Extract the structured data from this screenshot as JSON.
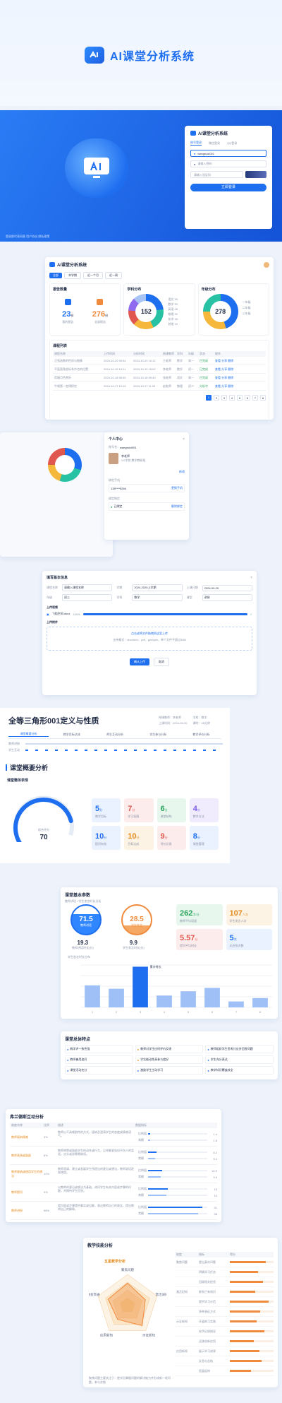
{
  "header": {
    "title": "AI课堂分析系统"
  },
  "login": {
    "title": "AI课堂分析系统",
    "tabs": [
      "账号登录",
      "微信登录",
      "QQ登录"
    ],
    "username": "wangruixi001",
    "password_placeholder": "请输入密码",
    "captcha_placeholder": "请输入验证码",
    "submit": "立即登录",
    "footer": "登录即代表同意 用户协议 隐私政策"
  },
  "dashboard": {
    "title": "AI课堂分析系统",
    "tabs": [
      "全部",
      "本学期",
      "近一个月",
      "近一周"
    ],
    "report_count_title": "报告数量",
    "report_a": {
      "value": "23",
      "unit": "份",
      "label": "我的报告"
    },
    "report_b": {
      "value": "276",
      "unit": "份",
      "label": "全部报告"
    },
    "subject_title": "学科分布",
    "subject_total": "152",
    "subject_legend": [
      "语文 35",
      "数学 30",
      "英语 28",
      "物理 22",
      "化学 18",
      "其他 19"
    ],
    "grade_title": "年级分布",
    "grade_total": "278",
    "grade_legend": [
      "一年级",
      "二年级",
      "三年级"
    ],
    "list_title": "课程列表",
    "list_columns": [
      "课程名称",
      "上传时间",
      "分析时间",
      "授课教师",
      "学科",
      "年级",
      "状态",
      "操作"
    ],
    "list_rows": [
      [
        "正弦函数的性质与图像",
        "2024-10-20 09:34",
        "2024-10-20 10:12",
        "王老师",
        "数学",
        "高一",
        "已完成",
        "查看 分享 删除"
      ],
      [
        "平面直角坐标系中点的位置",
        "2024-10-19 14:21",
        "2024-10-19 15:02",
        "李老师",
        "数学",
        "初一",
        "已完成",
        "查看 分享 删除"
      ],
      [
        "荷塘月色赏析",
        "2024-10-18 08:50",
        "2024-10-18 09:40",
        "张老师",
        "语文",
        "高一",
        "已完成",
        "查看 分享 删除"
      ],
      [
        "牛顿第一定律探究",
        "2024-10-17 10:15",
        "2024-10-17 11:03",
        "赵老师",
        "物理",
        "初二",
        "分析中",
        "查看 分享 删除"
      ]
    ],
    "pagination": [
      "1",
      "2",
      "3",
      "4",
      "5",
      "6",
      "7",
      "8"
    ]
  },
  "profile": {
    "title": "个人中心",
    "account_label": "账号名：",
    "account": "wangruixi001",
    "name": "李老师",
    "org": "XX学校 数学教研组",
    "phone_label": "绑定手机",
    "phone": "138****5266",
    "change": "更换手机",
    "wechat_label": "绑定微信",
    "wechat": "已绑定",
    "unbind": "解除绑定",
    "save": "修改"
  },
  "upload": {
    "title": "填写基本信息",
    "fields": [
      {
        "label": "课程名称",
        "value": "请输入课程名称"
      },
      {
        "label": "学期",
        "value": "2024-2025上学期"
      },
      {
        "label": "上课日期",
        "value": "2024-09-20"
      },
      {
        "label": "年级",
        "value": "初三"
      },
      {
        "label": "学科",
        "value": "数学"
      },
      {
        "label": "课型",
        "value": "讲授"
      }
    ],
    "file_section": "上传视频",
    "file_name": "飞船空间.docx",
    "file_progress": "100%",
    "file_pct": 100,
    "attach_section": "上传附件",
    "drop_hint": "点击或将文件拖拽到这里上传",
    "drop_note": "支持格式：doc/docx、pdf、ppt/pptx，单个文件不超过50M",
    "confirm": "确认上传",
    "cancel": "取消"
  },
  "report": {
    "lesson_title": "全等三角形001定义与性质",
    "meta": [
      "授课教师：李老师",
      "学科：数学",
      "上课时间：2024-09-20",
      "课时：45分钟"
    ],
    "tabs": [
      "课堂概要分析",
      "教学目标达成",
      "师生互动分析",
      "学生参与分析",
      "教学评价分析"
    ],
    "timeline_labels": [
      "教师讲授",
      "学生互动"
    ],
    "overview_title": "课堂概要分析",
    "overall_title": "课堂整体表现",
    "score_label": "综合评分",
    "score": "70",
    "score_pct": 70,
    "tiles": [
      {
        "value": "5",
        "unit": "分",
        "label": "教学目标",
        "color": "#eaf1ff",
        "text": "#1e6ff0"
      },
      {
        "value": "7",
        "unit": "分",
        "label": "学习氛围",
        "color": "#fdecec",
        "text": "#e0574f"
      },
      {
        "value": "6",
        "unit": "分",
        "label": "课堂结构",
        "color": "#e8f7ee",
        "text": "#27a35c"
      },
      {
        "value": "4",
        "unit": "分",
        "label": "教学方法",
        "color": "#f0ecfd",
        "text": "#7a5be6"
      },
      {
        "value": "10",
        "unit": "分",
        "label": "提问有效",
        "color": "#eaf1ff",
        "text": "#1e6ff0"
      },
      {
        "value": "10",
        "unit": "分",
        "label": "目标达成",
        "color": "#fdf3e4",
        "text": "#e58a1b"
      },
      {
        "value": "9",
        "unit": "分",
        "label": "评价反馈",
        "color": "#fdecec",
        "text": "#e0574f"
      },
      {
        "value": "8",
        "unit": "分",
        "label": "课堂管理",
        "color": "#eaf1ff",
        "text": "#1e6ff0"
      }
    ]
  },
  "basic": {
    "title": "课堂基本参数",
    "subtitle": "教师讲话 / 学生发言时长分析",
    "teacher_pct": "71.5",
    "teacher_label": "教师讲话",
    "student_pct": "28.5",
    "student_label": "学生发言",
    "teacher_min": "19.3",
    "teacher_min_label": "教师讲话时长(分)",
    "student_min": "9.9",
    "student_min_label": "学生发言时长(分)",
    "stats": [
      {
        "value": "262",
        "unit": "字/分",
        "label": "教师平均语速",
        "color": "#e8f7ee",
        "text": "#27a35c"
      },
      {
        "value": "107",
        "unit": "人次",
        "label": "学生发言人次",
        "color": "#fdf3e4",
        "text": "#e58a1b"
      },
      {
        "value": "5.57",
        "unit": "分",
        "label": "提问平均时长",
        "color": "#fdecec",
        "text": "#e0574f"
      },
      {
        "value": "5",
        "unit": "次",
        "label": "无应答次数",
        "color": "#eaf1ff",
        "text": "#1e6ff0"
      }
    ],
    "chart_title": "学生发言时长分布",
    "chart_tooltip": "累计时长"
  },
  "features": {
    "title": "课堂总体特点",
    "items": [
      {
        "text": "教学评一致性强",
        "color": "#1e6ff0"
      },
      {
        "text": "教师对学生应时评价反馈",
        "color": "#e58a1b"
      },
      {
        "text": "教师组织学生思考讨论并回答问题",
        "color": "#1e6ff0"
      },
      {
        "text": "教师善用追问",
        "color": "#1e6ff0"
      },
      {
        "text": "学生能动性高参与度好",
        "color": "#e58a1b"
      },
      {
        "text": "学生充分表达",
        "color": "#1e6ff0"
      },
      {
        "text": "课堂活动充分",
        "color": "#1e6ff0"
      },
      {
        "text": "激励学生主动学习",
        "color": "#1e6ff0"
      },
      {
        "text": "教学知识覆盖较全",
        "color": "#1e6ff0"
      }
    ]
  },
  "interaction": {
    "title": "弗兰德斯互动分析",
    "columns": [
      "维度名称",
      "比例",
      "描述",
      "数据指标"
    ],
    "rows": [
      {
        "name": "教师接纳情感",
        "ratio": "3%",
        "desc": "教师以不具威胁性的方式，接纳及澄清学生的态度或情感语气。",
        "m1": "比例值",
        "m2": "常模",
        "v1": "1.4",
        "v2": "1.8"
      },
      {
        "name": "教师表扬或鼓励",
        "ratio": "8%",
        "desc": "教师称赞或鼓励学生的动作或行为，以纾解紧张但不伤人的笑话，点头或说嗯嗯继续。",
        "m1": "比例值",
        "m2": "常模",
        "v1": "6.2",
        "v2": "5.4"
      },
      {
        "name": "教师接纳或使用学生的想法",
        "ratio": "12%",
        "desc": "教师澄清、建立或发展学生所提出的意见或想法，教师说话逐渐增加。",
        "m1": "比例值",
        "m2": "常模",
        "v1": "10.5",
        "v2": "9.9"
      },
      {
        "name": "教师提问",
        "ratio": "9%",
        "desc": "以教师的意见或想法为基础，询问学生有关内容或步骤的问题，并期待学生回答。",
        "m1": "比例值",
        "m2": "常模",
        "v1": "15",
        "v2": "14"
      },
      {
        "name": "教师讲授",
        "ratio": "58%",
        "desc": "就内容或步骤提供事实或见解，表达教师自己的观念，提出教师自己的解释。",
        "m1": "比例值",
        "m2": "常模",
        "v1": "41",
        "v2": "38"
      }
    ]
  },
  "skill": {
    "title": "教学技能分析",
    "radar_title": "五星教学分析",
    "radar_axes": [
      "聚焦问题",
      "激活旧知",
      "示证新知",
      "应用新知",
      "融会贯通"
    ],
    "footer": "聚焦问题主要关注于：使学员掌握问题的解决能力并形成新一轮问题，参与实践",
    "columns": [
      "维度",
      "指标",
      "得分"
    ],
    "groups": [
      "聚焦问题",
      "激活旧知",
      "示证新知",
      "应用新知"
    ],
    "rows": [
      {
        "name": "提出真实问题",
        "pct": 82
      },
      {
        "name": "明确学习任务",
        "pct": 64
      },
      {
        "name": "回顾相关经验",
        "pct": 75
      },
      {
        "name": "联系已有知识",
        "pct": 58
      },
      {
        "name": "提供学习示范",
        "pct": 88
      },
      {
        "name": "多种表征方式",
        "pct": 70
      },
      {
        "name": "开展练习实践",
        "pct": 62
      },
      {
        "name": "给予反馈指导",
        "pct": 79
      },
      {
        "name": "迁移创新应用",
        "pct": 55
      },
      {
        "name": "展示学习成果",
        "pct": 68
      },
      {
        "name": "反思与总结",
        "pct": 73
      },
      {
        "name": "拓展延伸",
        "pct": 49
      }
    ]
  },
  "chart_data": {
    "type": "bar",
    "categories": [
      "1",
      "2",
      "3",
      "4",
      "5",
      "6",
      "7",
      "8"
    ],
    "values": [
      5.2,
      4.4,
      9.6,
      2.8,
      3.8,
      4.6,
      1.4,
      2.2
    ],
    "xlabel": "",
    "ylabel": ""
  },
  "colors": {
    "brand": "#1e6ff0",
    "accent": "#f08a3c"
  }
}
